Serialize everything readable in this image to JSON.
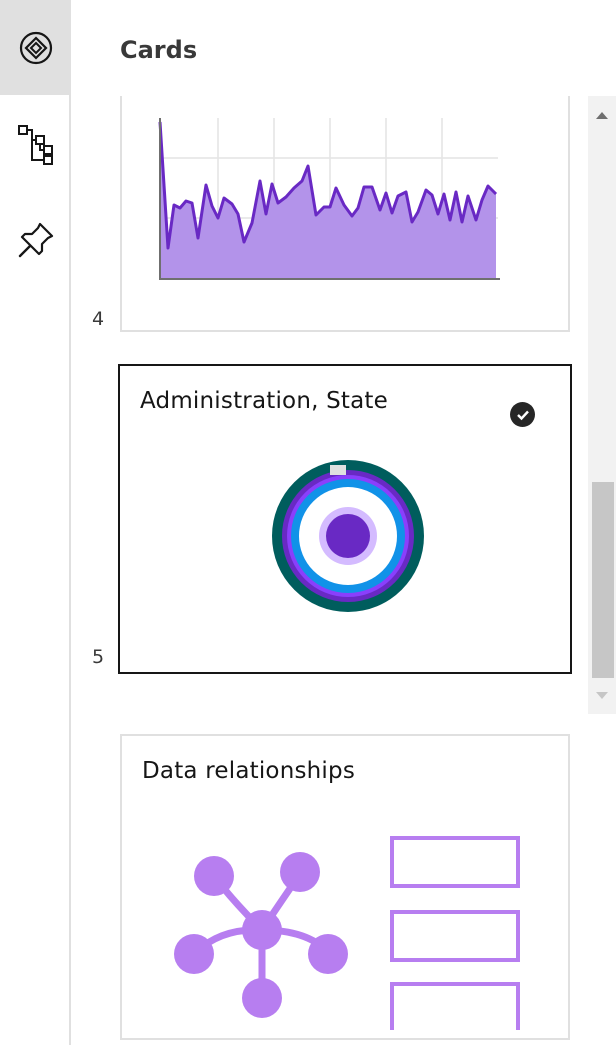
{
  "rail": {
    "items": [
      {
        "icon": "cards-icon",
        "active": true
      },
      {
        "icon": "hierarchy-icon",
        "active": false
      },
      {
        "icon": "pin-icon",
        "active": false
      }
    ]
  },
  "panel": {
    "title": "Cards",
    "cards": [
      {
        "index": "4",
        "title": "",
        "thumbnail": "area-chart-thumbnail"
      },
      {
        "index": "5",
        "title": "Administration, State",
        "selected": true,
        "thumbnail": "sunburst-thumbnail"
      },
      {
        "title": "Data relationships",
        "thumbnail": "network-thumbnail"
      }
    ]
  },
  "colors": {
    "accent": "#6929c4",
    "accent_light": "#a56eff",
    "teal": "#005d5d",
    "blue": "#1192e8",
    "selected_border": "#161616"
  }
}
